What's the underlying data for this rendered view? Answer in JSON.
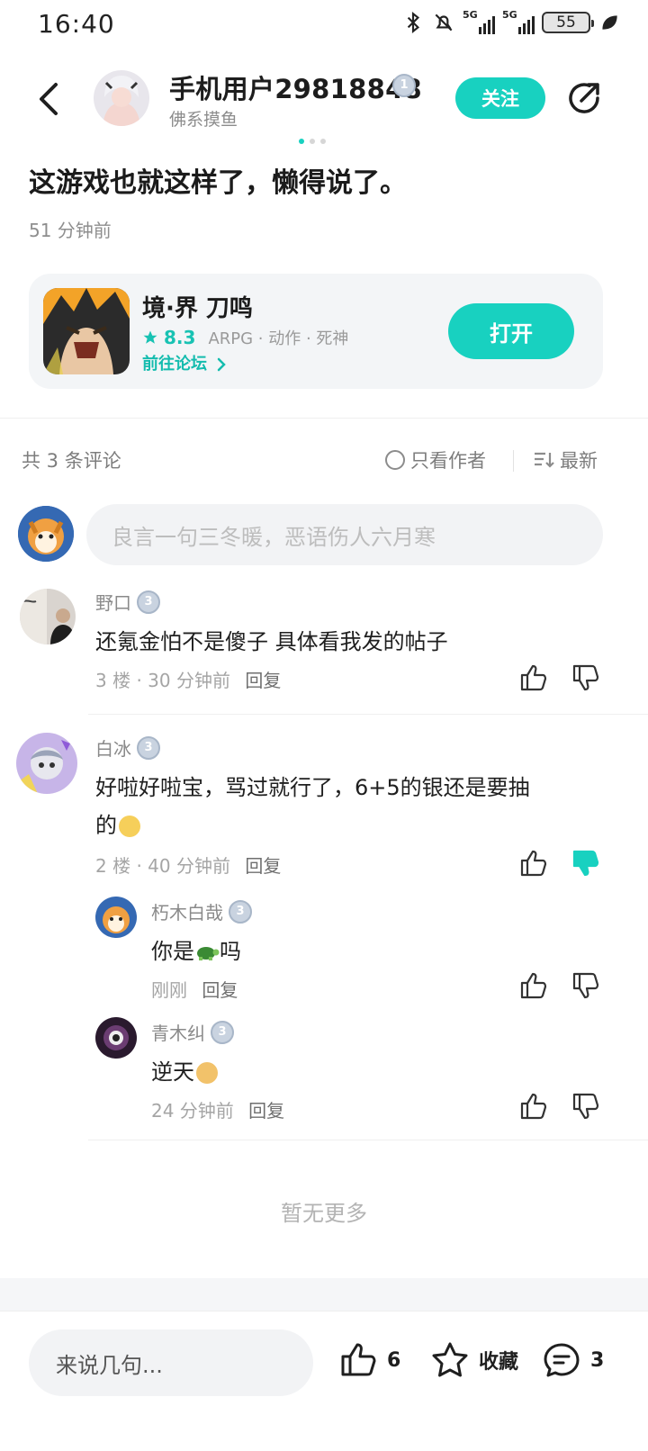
{
  "status_bar": {
    "time": "16:40",
    "signal_1_label": "5G",
    "signal_2_label": "5G",
    "battery": "55"
  },
  "header": {
    "author_name": "手机用户29818848",
    "author_level": "1",
    "author_subtitle": "佛系摸鱼",
    "follow_label": "关注"
  },
  "post": {
    "title": "这游戏也就这样了，懒得说了。",
    "time": "51 分钟前"
  },
  "game_card": {
    "name": "境·界 刀鸣",
    "rating": "8.3",
    "tags": "ARPG · 动作 · 死神",
    "forum_link": "前往论坛",
    "open_label": "打开"
  },
  "comments_bar": {
    "count_label": "共 3 条评论",
    "only_author_label": "只看作者",
    "sort_label": "最新"
  },
  "comment_input": {
    "placeholder": "良言一句三冬暖，恶语伤人六月寒"
  },
  "comments": [
    {
      "user": "野口",
      "level": "3",
      "text": "还氪金怕不是傻子  具体看我发的帖子",
      "meta": "3 楼 · 30 分钟前",
      "reply_label": "回复"
    },
    {
      "user": "白冰",
      "level": "3",
      "text_line1": "好啦好啦宝，骂过就行了，6+5的银还是要抽",
      "text_line2": "的",
      "meta": "2 楼 · 40 分钟前",
      "reply_label": "回复",
      "replies": [
        {
          "user": "朽木白哉",
          "level": "3",
          "text_before": "你是",
          "emoji": "turtle-emoji",
          "text_after": "吗",
          "meta": "刚刚",
          "reply_label": "回复"
        },
        {
          "user": "青木纠",
          "level": "3",
          "text": "逆天",
          "emoji": "face-emoji",
          "meta": "24 分钟前",
          "reply_label": "回复"
        }
      ]
    }
  ],
  "no_more": "暂无更多",
  "bottom_bar": {
    "say_placeholder": "来说几句...",
    "like_count": "6",
    "favorite_label": "收藏",
    "comment_count": "3"
  },
  "colors": {
    "accent": "#18d1c0",
    "text_primary": "#1f1f1f",
    "text_secondary": "#8a8a8a",
    "card_bg": "#f3f5f7"
  },
  "icons": [
    "back-icon",
    "share-icon",
    "star-icon",
    "chevron-right-icon",
    "circle-icon",
    "sort-icon",
    "thumb-up-icon",
    "thumb-down-icon",
    "favorite-star-icon",
    "comment-icon",
    "bluetooth-icon",
    "mute-icon"
  ]
}
